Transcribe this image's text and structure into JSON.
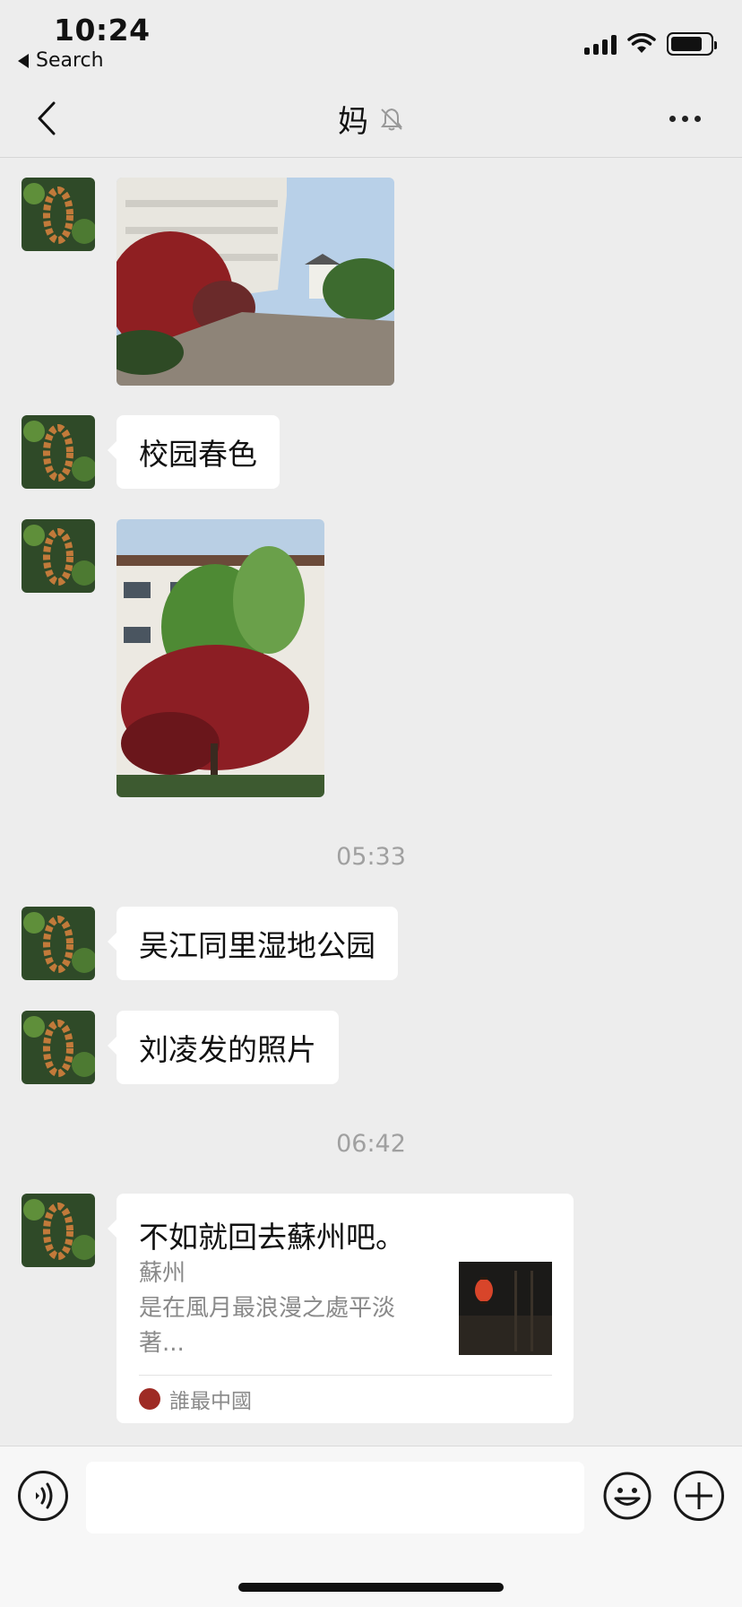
{
  "status_bar": {
    "time": "10:24",
    "back_app": "Search",
    "icons": [
      "signal-icon",
      "wifi-icon",
      "battery-icon"
    ]
  },
  "nav": {
    "title": "妈",
    "muted_icon": "bell-muted-icon",
    "back_icon": "chevron-left-icon",
    "more_icon": "ellipsis-icon"
  },
  "messages": [
    {
      "type": "image",
      "alt": "image-building-red-maple"
    },
    {
      "type": "text",
      "text": "校园春色"
    },
    {
      "type": "image",
      "alt": "image-red-maple-tree"
    },
    {
      "type": "timestamp",
      "text": "05:33"
    },
    {
      "type": "text",
      "text": "吴江同里湿地公园"
    },
    {
      "type": "text",
      "text": "刘凌发的照片"
    },
    {
      "type": "timestamp",
      "text": "06:42"
    },
    {
      "type": "link",
      "title": "不如就回去蘇州吧。",
      "subtitle_line1": "蘇州",
      "subtitle_line2": "是在風月最浪漫之處平淡",
      "subtitle_line3": "著...",
      "source": "誰最中國"
    }
  ],
  "input_bar": {
    "placeholder": "",
    "voice_icon": "voice-icon",
    "emoji_icon": "emoji-icon",
    "plus_icon": "plus-icon"
  },
  "colors": {
    "background": "#ededed",
    "bubble": "#ffffff",
    "timestamp": "#a0a0a0"
  }
}
